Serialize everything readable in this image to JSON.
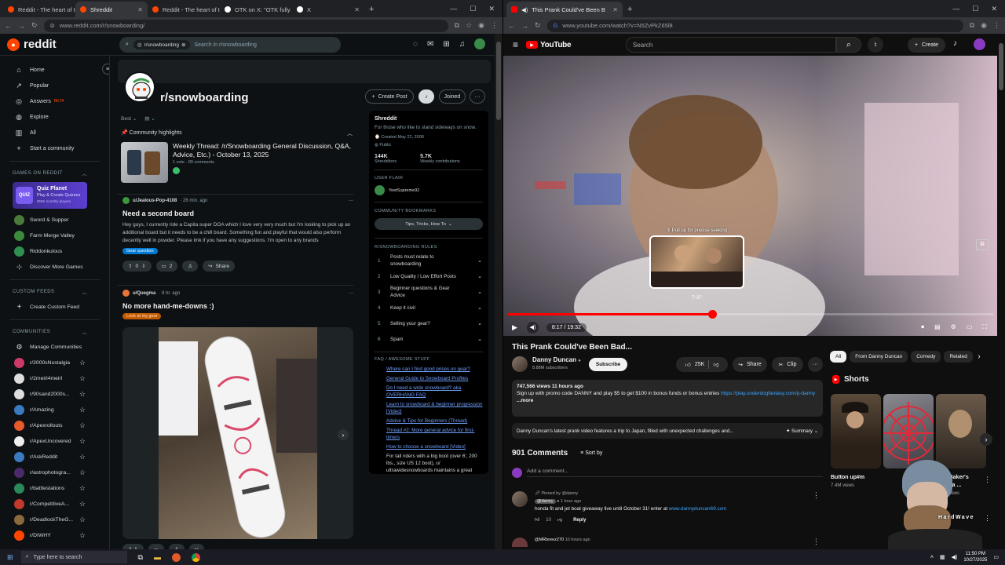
{
  "left_browser": {
    "tabs": [
      {
        "title": "Reddit - The heart of th",
        "color": "#ff4500",
        "active": false
      },
      {
        "title": "Shreddit",
        "color": "#ff4500",
        "active": true
      },
      {
        "title": "Reddit - The heart of th",
        "color": "#ff4500",
        "active": false
      },
      {
        "title": "OTK on X: \"OTK fully su",
        "color": "#ffffff",
        "active": false
      },
      {
        "title": "X",
        "color": "#ffffff",
        "active": false
      }
    ],
    "url": "www.reddit.com/r/snowboarding/"
  },
  "reddit": {
    "logo_text": "reddit",
    "search_chip": "r/snowboarding",
    "search_placeholder": "Search in r/snowboarding",
    "nav": [
      {
        "label": "Home",
        "icon": "⌂"
      },
      {
        "label": "Popular",
        "icon": "↗"
      },
      {
        "label": "Answers",
        "icon": "◎",
        "badge": "BETA"
      },
      {
        "label": "Explore",
        "icon": "◍"
      },
      {
        "label": "All",
        "icon": "▥"
      },
      {
        "label": "Start a community",
        "icon": "+"
      }
    ],
    "games_heading": "GAMES ON REDDIT",
    "quiz": {
      "title": "Quiz Planet",
      "subtitle": "Play & Create Quizzes",
      "stat": "850K monthly players"
    },
    "games": [
      {
        "label": "Sword & Supper",
        "color": "#4a7a3a"
      },
      {
        "label": "Farm Merge Valley",
        "color": "#3c8a3c"
      },
      {
        "label": "Riddonkulous",
        "color": "#2f8f4f"
      },
      {
        "label": "Discover More Games",
        "color": ""
      }
    ],
    "custom_feeds_heading": "CUSTOM FEEDS",
    "create_feed": "Create Custom Feed",
    "communities_heading": "COMMUNITIES",
    "manage": "Manage Communities",
    "communities": [
      {
        "label": "r/2000sNostalgia",
        "color": "#cc3a6a"
      },
      {
        "label": "r/2meirl4meirl",
        "color": "#dddddd"
      },
      {
        "label": "r/90sand2000s...",
        "color": "#dddddd"
      },
      {
        "label": "r/Amazing",
        "color": "#3a7ac0"
      },
      {
        "label": "r/Apexrollouts",
        "color": "#e85a2a"
      },
      {
        "label": "r/ApexUncovered",
        "color": "#eeeeee"
      },
      {
        "label": "r/AskReddit",
        "color": "#3a7ac0"
      },
      {
        "label": "r/astrophotogra...",
        "color": "#4a2a6a"
      },
      {
        "label": "r/battlestations",
        "color": "#2a8a5a"
      },
      {
        "label": "r/CompetitiveA...",
        "color": "#c0392b"
      },
      {
        "label": "r/DeadlockTheG...",
        "color": "#8a6a3a"
      },
      {
        "label": "r/DIWHY",
        "color": "#ff4500"
      }
    ],
    "community": {
      "name": "r/snowboarding",
      "create_post": "Create Post",
      "joined": "Joined",
      "sort": "Best",
      "highlights": "Community highlights",
      "weekly": {
        "title": "Weekly Thread: /r/Snowboarding General Discussion, Q&A, Advice, Etc.) - October 13, 2025",
        "meta": "1 vote · 89 comments"
      },
      "post1": {
        "user": "u/Jealous-Pop-4108",
        "time": "· 26 min. ago",
        "title": "Need a second board",
        "body": "Hey guys, I currently ride a Capita super DOA which I love very very much but I'm looking to pick up an additional board but it needs to be a chill board. Something fun and playful that would also perform decently well in powder. Please lmk if you have any suggestions. I'm open to any brands",
        "flair": "Gear question",
        "votes": "0",
        "comments": "2",
        "share": "Share"
      },
      "post2": {
        "user": "u/Quegma",
        "time": "· 8 hr. ago",
        "title": "No more hand-me-downs :)",
        "flair": "Look at my gear"
      },
      "about": {
        "title": "Shreddit",
        "desc": "For those who like to stand sideways on snow.",
        "created": "Created May 22, 2008",
        "visibility": "Public",
        "members": "144K",
        "members_label": "Shredditors",
        "weekly": "5.7K",
        "weekly_label": "Weekly contributions",
        "user_flair_heading": "USER FLAIR",
        "user_flair": "YeetSupreme92",
        "bookmarks_heading": "COMMUNITY BOOKMARKS",
        "bookmark": "Tips, Tricks, How To",
        "rules_heading": "R/SNOWBOARDING RULES",
        "rules": [
          "Posts must relate to snowboarding",
          "Low Quality / Low Effort Posts",
          "Beginner questions & Gear Advice",
          "Keep it civil",
          "Selling your gear?",
          "Spam"
        ],
        "faq_heading": "FAQ / AWESOME STUFF",
        "faq": [
          "Where can I find good prices on gear?",
          "General Guide to Snowboard Profiles",
          "Do I need a wide snowboard? aka OVERHANG FAQ",
          "Learn to snowboard & beginner progression [Video]",
          "Advice & Tips for Beginners (Thread)",
          "Thread #2: More general advice for first-timers",
          "How to choose a snowboard [Video]"
        ],
        "faq_tail": "For tall riders with a big boot (over 6', 200 lbs., size US 12 boot), u/ ultrawidesnowboards maintains a great"
      }
    }
  },
  "right_browser": {
    "tab_title": "This Prank Could've Been B",
    "url": "www.youtube.com/watch?v=N5ZvPkZ65l8"
  },
  "youtube": {
    "logo": "YouTube",
    "search_placeholder": "Search",
    "create": "Create",
    "video": {
      "seek_hint": "⇕ Pull up for precise seeking",
      "preview_time": "7:37",
      "time": "8:17 / 19:32",
      "progress": 0.42
    },
    "title": "This Prank Could've Been Bad...",
    "channel": "Danny Duncan",
    "subscribers": "8.88M subscribers",
    "subscribe": "Subscribe",
    "likes": "25K",
    "share": "Share",
    "clip": "Clip",
    "desc_stats": "747,566 views  11 hours ago",
    "desc_line": "Sign up with promo code DANNY and play $5 to get $100 in bonus funds or bonus entries",
    "desc_link": "https://play.underdogfantasy.com/p-danny",
    "more": "...more",
    "summary_text": "Danny Duncan's latest prank video features a trip to Japan, filled with unexpected challenges and...",
    "summary_label": "Summary",
    "comments_count": "901 Comments",
    "sort_by": "Sort by",
    "add_comment": "Add a comment...",
    "pinned": "Pinned by @danny",
    "comment_author": "@danny",
    "comment_time": "1 hour ago",
    "comment_text": "honda fit and jet boat giveaway live until October 31! enter at",
    "comment_link": "www.dannyduncan69.com",
    "comment_likes": "10",
    "reply": "Reply",
    "next_author": "@MRbreez270",
    "next_time": "10 hours ago",
    "chips": [
      "All",
      "From Danny Duncan",
      "Comedy",
      "Related"
    ],
    "shorts_heading": "Shorts",
    "shorts": [
      {
        "title": "Button up#m",
        "views": "7.4M views"
      },
      {
        "title": "",
        "views": ""
      },
      {
        "title": "Troy Baker's Indiana ...",
        "views": "2.2M views"
      }
    ],
    "webcam_text": "HardWave"
  },
  "taskbar": {
    "search": "Type here to search",
    "time": "11:50 PM",
    "date": "10/27/2025"
  }
}
